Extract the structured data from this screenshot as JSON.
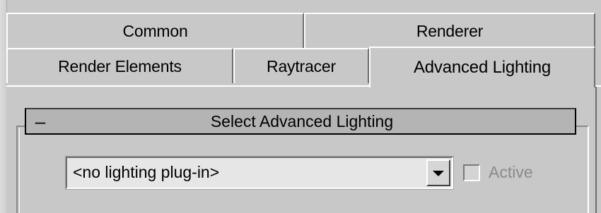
{
  "tabs_row1": [
    {
      "label": "Common"
    },
    {
      "label": "Renderer"
    }
  ],
  "tabs_row2": [
    {
      "label": "Render Elements"
    },
    {
      "label": "Raytracer"
    },
    {
      "label": "Advanced Lighting",
      "active": true
    }
  ],
  "rollout": {
    "toggle_symbol": "–",
    "title": "Select Advanced Lighting"
  },
  "lighting_select": {
    "value": "<no lighting plug-in>"
  },
  "active_checkbox": {
    "label": "Active",
    "checked": false,
    "disabled": true
  }
}
